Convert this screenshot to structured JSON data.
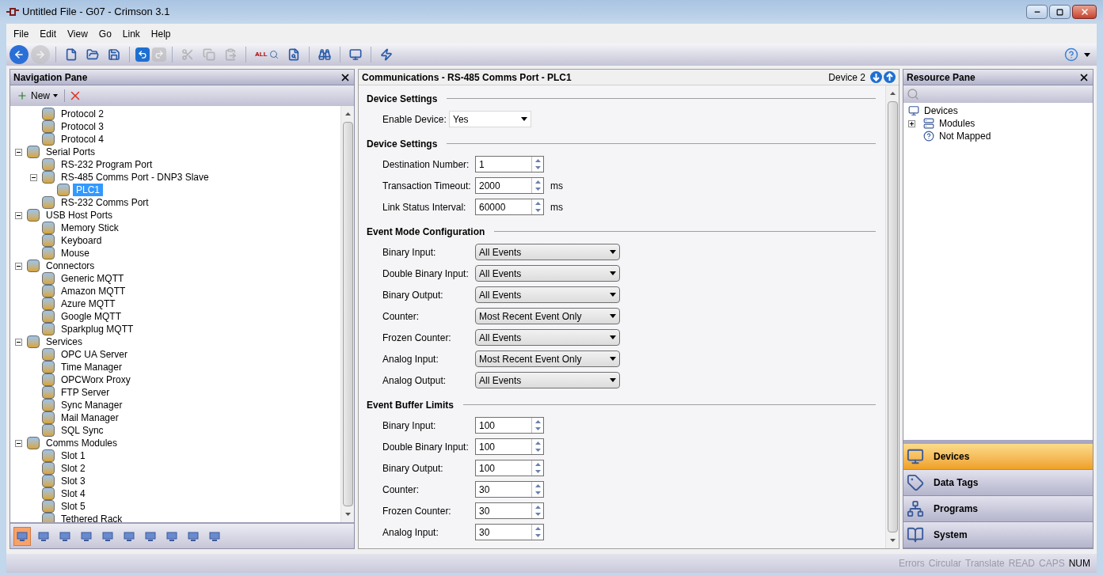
{
  "window": {
    "title": "Untitled File - G07 - Crimson 3.1"
  },
  "menu": [
    "File",
    "Edit",
    "View",
    "Go",
    "Link",
    "Help"
  ],
  "toolbar": [
    {
      "kind": "back",
      "disabled": false
    },
    {
      "kind": "forward",
      "disabled": true
    },
    {
      "kind": "sep"
    },
    {
      "kind": "new"
    },
    {
      "kind": "open"
    },
    {
      "kind": "save"
    },
    {
      "kind": "sep"
    },
    {
      "kind": "undo",
      "disabled": false
    },
    {
      "kind": "redo",
      "disabled": true
    },
    {
      "kind": "sep"
    },
    {
      "kind": "cut",
      "disabled": true
    },
    {
      "kind": "copy",
      "disabled": true
    },
    {
      "kind": "paste",
      "disabled": true
    },
    {
      "kind": "sep"
    },
    {
      "kind": "findall",
      "label": "ALL"
    },
    {
      "kind": "find"
    },
    {
      "kind": "sep"
    },
    {
      "kind": "binoculars"
    },
    {
      "kind": "sep"
    },
    {
      "kind": "monitor"
    },
    {
      "kind": "sep"
    },
    {
      "kind": "bolt"
    }
  ],
  "navigation": {
    "title": "Navigation Pane",
    "new_button": "New",
    "tree": [
      {
        "children": [
          {
            "label": "Protocol 2"
          },
          {
            "label": "Protocol 3"
          },
          {
            "label": "Protocol 4"
          }
        ]
      },
      {
        "label": "Serial Ports",
        "expanded": true,
        "children": [
          {
            "label": "RS-232 Program Port"
          },
          {
            "label": "RS-485 Comms Port - DNP3 Slave",
            "expanded": true,
            "children": [
              {
                "label": "PLC1",
                "selected": true
              }
            ]
          },
          {
            "label": "RS-232 Comms Port"
          }
        ]
      },
      {
        "label": "USB Host Ports",
        "expanded": true,
        "children": [
          {
            "label": "Memory Stick"
          },
          {
            "label": "Keyboard"
          },
          {
            "label": "Mouse"
          }
        ]
      },
      {
        "label": "Connectors",
        "expanded": true,
        "children": [
          {
            "label": "Generic MQTT"
          },
          {
            "label": "Amazon MQTT"
          },
          {
            "label": "Azure MQTT"
          },
          {
            "label": "Google MQTT"
          },
          {
            "label": "Sparkplug MQTT"
          }
        ]
      },
      {
        "label": "Services",
        "expanded": true,
        "children": [
          {
            "label": "OPC UA Server"
          },
          {
            "label": "Time Manager"
          },
          {
            "label": "OPCWorx Proxy"
          },
          {
            "label": "FTP Server"
          },
          {
            "label": "Sync Manager"
          },
          {
            "label": "Mail Manager"
          },
          {
            "label": "SQL Sync"
          }
        ]
      },
      {
        "label": "Comms Modules",
        "expanded": true,
        "children": [
          {
            "label": "Slot 1"
          },
          {
            "label": "Slot 2"
          },
          {
            "label": "Slot 3"
          },
          {
            "label": "Slot 4"
          },
          {
            "label": "Slot 5"
          },
          {
            "label": "Tethered Rack"
          }
        ]
      }
    ],
    "views": [
      {
        "selected": true
      },
      {
        "selected": false
      },
      {
        "selected": false
      },
      {
        "selected": false
      },
      {
        "selected": false
      },
      {
        "selected": false
      },
      {
        "selected": false
      },
      {
        "selected": false
      },
      {
        "selected": false
      },
      {
        "selected": false
      }
    ]
  },
  "editor": {
    "title": "Communications - RS-485 Comms Port - PLC1",
    "device": "Device 2",
    "sections": [
      {
        "title": "Device Settings",
        "rows": [
          {
            "kind": "dropdown",
            "label": "Enable Device:",
            "value": "Yes"
          }
        ]
      },
      {
        "title": "Device Settings",
        "rows": [
          {
            "kind": "spin",
            "label": "Destination Number:",
            "value": "1"
          },
          {
            "kind": "spin",
            "label": "Transaction Timeout:",
            "value": "2000",
            "unit": "ms"
          },
          {
            "kind": "spin",
            "label": "Link Status Interval:",
            "value": "60000",
            "unit": "ms"
          }
        ]
      },
      {
        "title": "Event Mode Configuration",
        "rows": [
          {
            "kind": "dropdown",
            "label": "Binary Input:",
            "value": "All Events"
          },
          {
            "kind": "dropdown",
            "label": "Double Binary Input:",
            "value": "All Events"
          },
          {
            "kind": "dropdown",
            "label": "Binary Output:",
            "value": "All Events"
          },
          {
            "kind": "dropdown",
            "label": "Counter:",
            "value": "Most Recent Event Only"
          },
          {
            "kind": "dropdown",
            "label": "Frozen Counter:",
            "value": "All Events"
          },
          {
            "kind": "dropdown",
            "label": "Analog Input:",
            "value": "Most Recent Event Only"
          },
          {
            "kind": "dropdown",
            "label": "Analog Output:",
            "value": "All Events"
          }
        ]
      },
      {
        "title": "Event Buffer Limits",
        "rows": [
          {
            "kind": "spin",
            "label": "Binary Input:",
            "value": "100"
          },
          {
            "kind": "spin",
            "label": "Double Binary Input:",
            "value": "100"
          },
          {
            "kind": "spin",
            "label": "Binary Output:",
            "value": "100"
          },
          {
            "kind": "spin",
            "label": "Counter:",
            "value": "30"
          },
          {
            "kind": "spin",
            "label": "Frozen Counter:",
            "value": "30"
          },
          {
            "kind": "spin",
            "label": "Analog Input:",
            "value": "30"
          }
        ]
      }
    ]
  },
  "resources": {
    "title": "Resource Pane",
    "tree": [
      {
        "label": "Devices",
        "kind": "devices"
      },
      {
        "label": "Modules",
        "kind": "modules",
        "expanded": false
      },
      {
        "label": "Not Mapped",
        "kind": "unknown"
      }
    ],
    "categories": [
      {
        "label": "Devices",
        "selected": true
      },
      {
        "label": "Data Tags",
        "selected": false
      },
      {
        "label": "Programs",
        "selected": false
      },
      {
        "label": "System",
        "selected": false
      }
    ]
  },
  "status_bar": [
    {
      "label": "Errors",
      "on": false
    },
    {
      "label": "Circular",
      "on": false
    },
    {
      "label": "Translate",
      "on": false
    },
    {
      "label": "READ",
      "on": false
    },
    {
      "label": "CAPS",
      "on": false
    },
    {
      "label": "NUM",
      "on": true
    }
  ]
}
